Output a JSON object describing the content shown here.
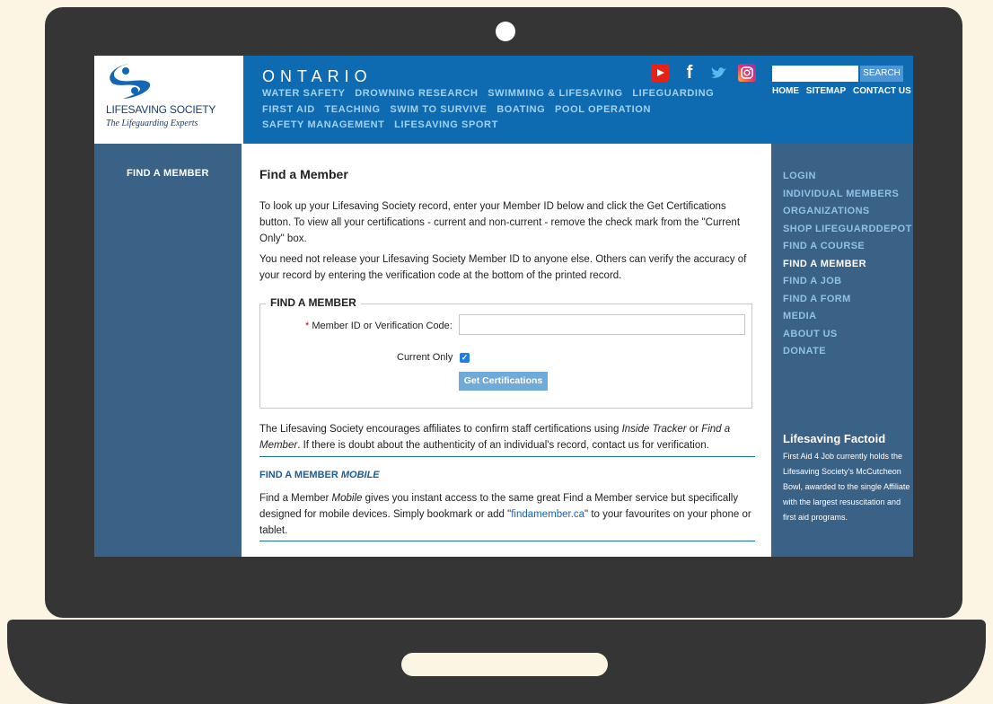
{
  "site": {
    "logo_name": "LIFESAVING SOCIETY",
    "logo_tagline": "The Lifeguarding Experts",
    "region": "ONTARIO",
    "top_nav": [
      "WATER SAFETY",
      "DROWNING RESEARCH",
      "SWIMMING & LIFESAVING",
      "LIFEGUARDING",
      "FIRST AID",
      "TEACHING",
      "SWIM TO SURVIVE",
      "BOATING",
      "POOL OPERATION",
      "SAFETY MANAGEMENT",
      "LIFESAVING SPORT"
    ],
    "search_button": "SEARCH",
    "search_value": "",
    "util_nav": {
      "home": "HOME",
      "sitemap": "SITEMAP",
      "contact": "CONTACT US"
    },
    "social_icons": [
      "youtube-icon",
      "facebook-icon",
      "twitter-icon",
      "instagram-icon"
    ]
  },
  "left_sidebar": {
    "title": "FIND A MEMBER"
  },
  "main": {
    "heading": "Find a Member",
    "para1": "To look up your Lifesaving Society record, enter your Member ID below and click the Get Certifications button. To view all your certifications - current and non-current - remove the check mark from the \"Current Only\" box.",
    "para2": "You need not release your Lifesaving Society Member ID to anyone else. Others can verify the accuracy of your record by entering the verification code at the bottom of the printed record.",
    "form": {
      "legend": "FIND A MEMBER",
      "required_marker": "*",
      "member_label": "Member ID or Verification Code:",
      "member_value": "",
      "current_only_label": "Current Only",
      "current_only_checked": true,
      "submit_label": "Get Certifications"
    },
    "para3": {
      "a": "The Lifesaving Society encourages affiliates to confirm staff certifications using ",
      "b": "Inside Tracker",
      "c": " or ",
      "d": "Find a Member",
      "e": ". If there is doubt about the authenticity of an individual's record, contact us for verification."
    },
    "mobile": {
      "title_a": "FIND A MEMBER ",
      "title_b": "MOBILE",
      "text_a": "Find a Member ",
      "text_b": "Mobile",
      "text_c": " gives you instant access to the same great Find a Member service but specifically designed for mobile devices. Simply bookmark or add \"",
      "link": "findamember.ca",
      "text_d": "\" to your favourites on your phone or tablet."
    }
  },
  "right_sidebar": {
    "items": [
      "LOGIN",
      "INDIVIDUAL MEMBERS",
      "ORGANIZATIONS",
      "SHOP LIFEGUARDDEPOT",
      "FIND A COURSE",
      "FIND A MEMBER",
      "FIND A JOB",
      "FIND A FORM",
      "MEDIA",
      "ABOUT US",
      "DONATE"
    ],
    "active_index": 5,
    "factoid_title": "Lifesaving Factoid",
    "factoid_text": "First Aid 4 Job currently holds the Lifesaving Society's McCutcheon Bowl, awarded to the single Affiliate with the largest resuscitation and first aid programs."
  },
  "colors": {
    "header_blue": "#0e6ab1",
    "sidebar_blue": "#3a6186",
    "desk": "#fdf5e3",
    "laptop": "#353535"
  }
}
